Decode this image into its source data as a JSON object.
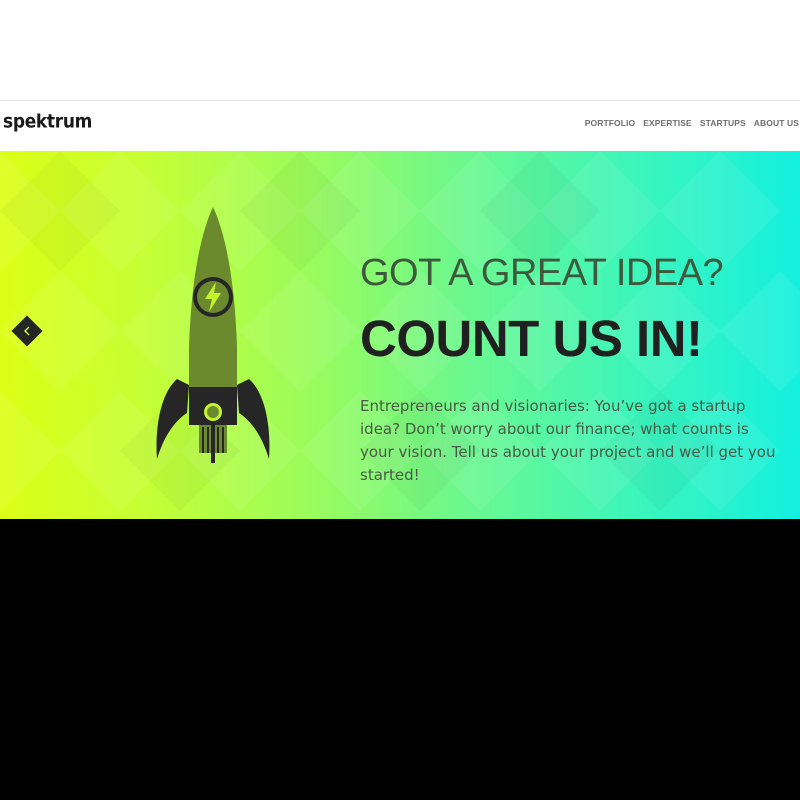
{
  "header": {
    "logo": "spektrum",
    "nav": [
      {
        "label": "PORTFOLIO"
      },
      {
        "label": "EXPERTISE"
      },
      {
        "label": "STARTUPS"
      },
      {
        "label": "ABOUT US"
      }
    ]
  },
  "hero": {
    "subtitle": "GOT A GREAT IDEA?",
    "title": "COUNT US IN!",
    "text": "Entrepreneurs and visionaries: You’ve got a startup idea? Don’t worry about our finance; what counts is your vision. Tell us about your project and we’ll get you started!",
    "prev_icon": "chevron-left-icon",
    "illustration": "rocket-icon"
  },
  "colors": {
    "gradient_start": "#dcff16",
    "gradient_end": "#14f0df",
    "rocket_body": "#6b8a2e",
    "rocket_dark": "#262626",
    "rocket_accent": "#c4f52c"
  }
}
